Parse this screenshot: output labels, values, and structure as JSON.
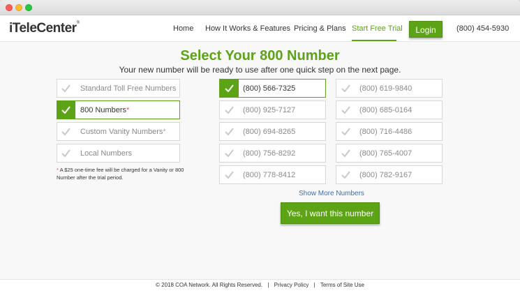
{
  "header": {
    "logo": {
      "i": "i",
      "tele": "Tele",
      "center": "Center"
    },
    "nav": [
      "Home",
      "How It Works & Features",
      "Pricing & Plans",
      "Start Free Trial"
    ],
    "login_label": "Login",
    "phone": "(800) 454-5930"
  },
  "main": {
    "title": "Select Your 800 Number",
    "subtitle": "Your new number will be ready to use after one quick step on the next page.",
    "number_types": [
      {
        "label": "Standard Toll Free Numbers",
        "selected": false
      },
      {
        "label": "800 Numbers",
        "star": "*",
        "selected": true
      },
      {
        "label": "Custom Vanity Numbers",
        "star": "*",
        "selected": false
      },
      {
        "label": "Local Numbers",
        "selected": false
      }
    ],
    "note": {
      "star": "*",
      "text": " A $25 one-time fee will be charged for a Vanity or 800 Number after the trial period."
    },
    "numbers_col1": [
      {
        "number": "(800) 566-7325",
        "selected": true
      },
      {
        "number": "(800) 925-7127",
        "selected": false
      },
      {
        "number": "(800) 694-8265",
        "selected": false
      },
      {
        "number": "(800) 756-8292",
        "selected": false
      },
      {
        "number": "(800) 778-8412",
        "selected": false
      }
    ],
    "numbers_col2": [
      {
        "number": "(800) 619-9840",
        "selected": false
      },
      {
        "number": "(800) 685-0164",
        "selected": false
      },
      {
        "number": "(800) 716-4486",
        "selected": false
      },
      {
        "number": "(800) 765-4007",
        "selected": false
      },
      {
        "number": "(800) 782-9167",
        "selected": false
      }
    ],
    "show_more": "Show More Numbers",
    "cta": "Yes, I want this number"
  },
  "footer": {
    "copyright": "© 2018 COA Network.  All Rights Reserved.",
    "sep": "|",
    "privacy": "Privacy Policy",
    "terms": "Terms of Site Use"
  },
  "colors": {
    "accent": "#5ca415",
    "link": "#3b6fb6"
  }
}
